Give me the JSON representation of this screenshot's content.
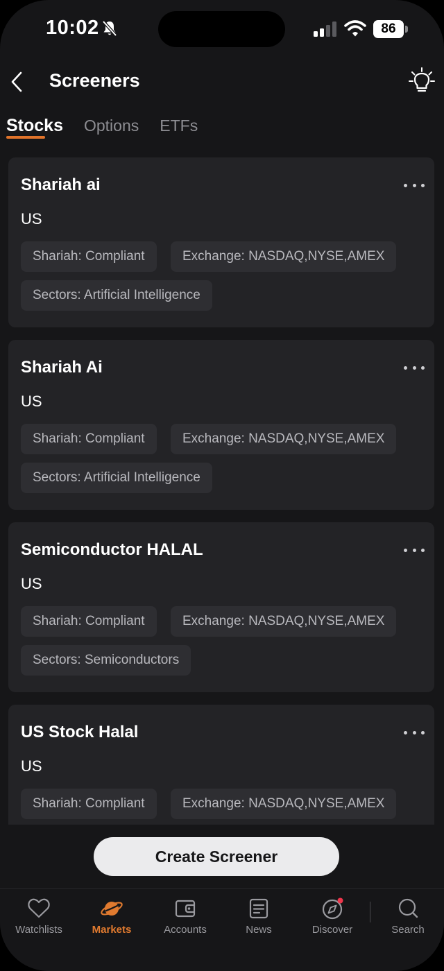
{
  "status_bar": {
    "time": "10:02",
    "battery": "86",
    "icons": [
      "bell-slash-icon",
      "cellular-signal-icon",
      "wifi-icon",
      "battery-icon"
    ]
  },
  "header": {
    "title": "Screeners",
    "back_icon": "chevron-left-icon",
    "action_icon": "lightbulb-icon"
  },
  "tabs": [
    {
      "label": "Stocks",
      "active": true
    },
    {
      "label": "Options",
      "active": false
    },
    {
      "label": "ETFs",
      "active": false
    }
  ],
  "screeners": [
    {
      "name": "Shariah ai",
      "market": "US",
      "filters": [
        "Shariah: Compliant",
        "Exchange: NASDAQ,NYSE,AMEX",
        "Sectors: Artificial Intelligence"
      ]
    },
    {
      "name": "Shariah Ai",
      "market": "US",
      "filters": [
        "Shariah: Compliant",
        "Exchange: NASDAQ,NYSE,AMEX",
        "Sectors: Artificial Intelligence"
      ]
    },
    {
      "name": "Semiconductor HALAL",
      "market": "US",
      "filters": [
        "Shariah: Compliant",
        "Exchange: NASDAQ,NYSE,AMEX",
        "Sectors: Semiconductors"
      ]
    },
    {
      "name": "US Stock Halal",
      "market": "US",
      "filters": [
        "Shariah: Compliant",
        "Exchange: NASDAQ,NYSE,AMEX"
      ]
    }
  ],
  "create_button": {
    "label": "Create Screener"
  },
  "bottom_nav": {
    "active_color": "#e07a2f",
    "items": [
      {
        "label": "Watchlists",
        "icon": "heart-icon"
      },
      {
        "label": "Markets",
        "icon": "planet-icon"
      },
      {
        "label": "Accounts",
        "icon": "wallet-icon"
      },
      {
        "label": "News",
        "icon": "news-icon"
      },
      {
        "label": "Discover",
        "icon": "compass-icon"
      },
      {
        "label": "Search",
        "icon": "search-icon"
      }
    ]
  }
}
